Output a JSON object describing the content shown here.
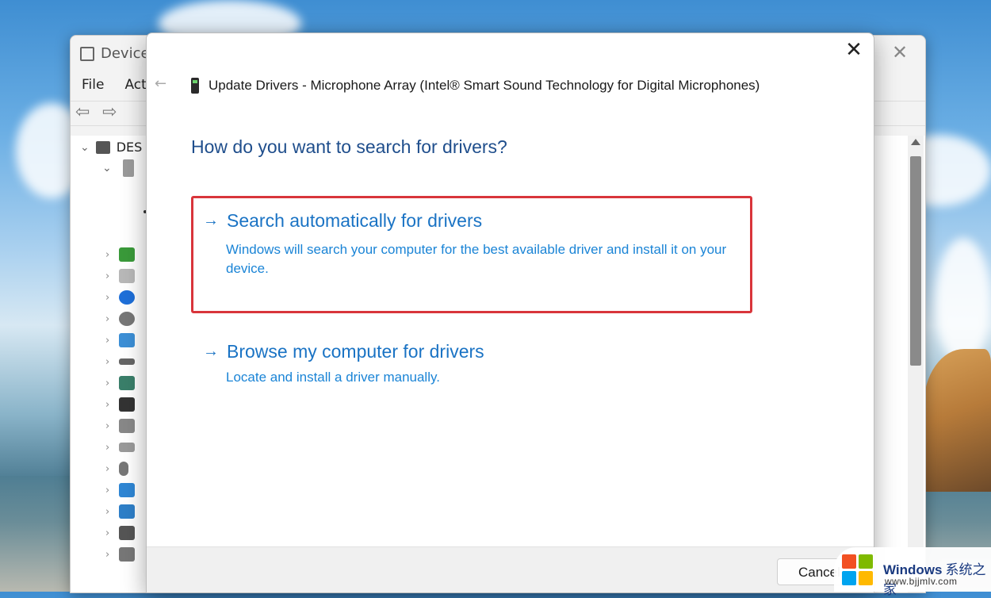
{
  "device_manager": {
    "title": "Device",
    "menu": [
      "File",
      "Acti"
    ],
    "tree_root": "DES"
  },
  "dialog": {
    "header_title": "Update Drivers - Microphone Array (Intel® Smart Sound Technology for Digital Microphones)",
    "question": "How do you want to search for drivers?",
    "options": [
      {
        "title": "Search automatically for drivers",
        "description": "Windows will search your computer for the best available driver and install it on your device."
      },
      {
        "title": "Browse my computer for drivers",
        "description": "Locate and install a driver manually."
      }
    ],
    "cancel_label": "Cancel"
  },
  "watermark": {
    "name": "Windows",
    "name_cn": "系统之家",
    "url": "www.bjjmlv.com"
  },
  "colors": {
    "question": "#1f4e8c",
    "link": "#1a73c4",
    "highlight_border": "#d9353b"
  }
}
